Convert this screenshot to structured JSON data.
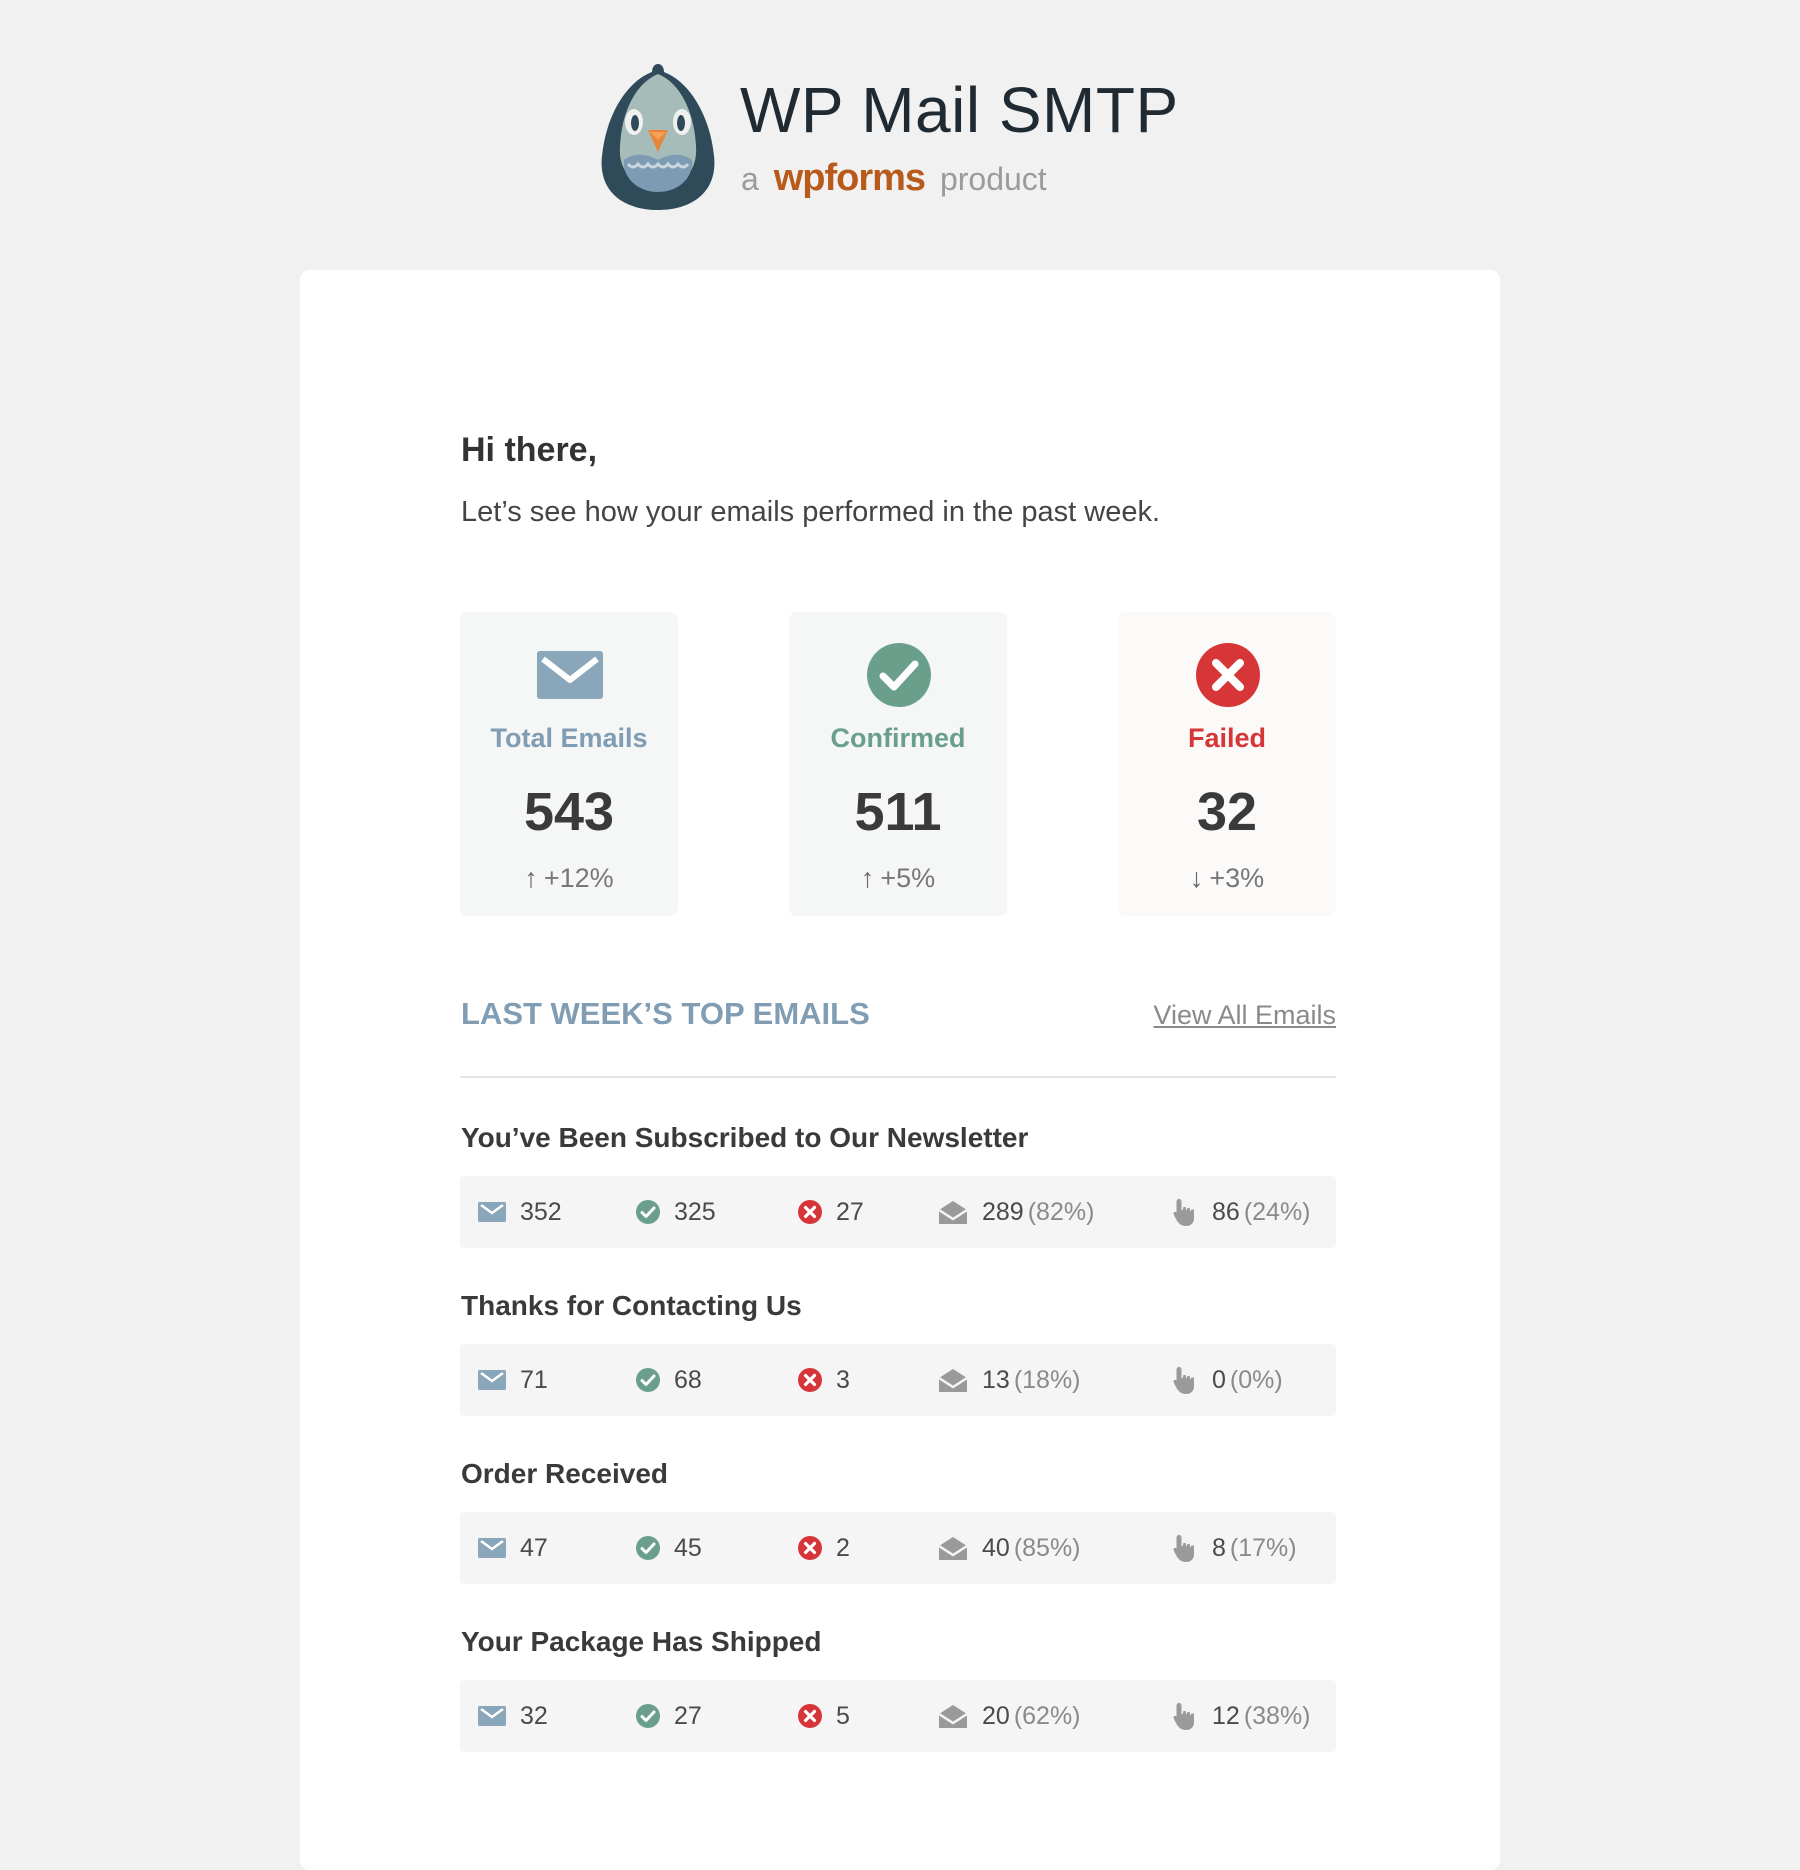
{
  "brand": {
    "title": "WP Mail SMTP",
    "sub_prefix": "a",
    "sub_brand": "wpforms",
    "sub_suffix": "product"
  },
  "greeting": "Hi there,",
  "intro": "Let’s see how your emails performed in the past week.",
  "stats": [
    {
      "label": "Total Emails",
      "value": "543",
      "arrow": "↑",
      "change": "+12%",
      "icon": "envelope-icon",
      "color": "#809db3"
    },
    {
      "label": "Confirmed",
      "value": "511",
      "arrow": "↑",
      "change": "+5%",
      "icon": "check-circle-icon",
      "color": "#6aa08b"
    },
    {
      "label": "Failed",
      "value": "32",
      "arrow": "↓",
      "change": "+3%",
      "icon": "x-circle-icon",
      "color": "#d63638"
    }
  ],
  "section": {
    "title": "LAST WEEK’S TOP EMAILS",
    "view_all": "View All Emails"
  },
  "emails": [
    {
      "title": "You’ve Been Subscribed to Our Newsletter",
      "total": "352",
      "confirmed": "325",
      "failed": "27",
      "opened": "289",
      "opened_pct": "(82%)",
      "clicked": "86",
      "clicked_pct": "(24%)"
    },
    {
      "title": "Thanks for Contacting Us",
      "total": "71",
      "confirmed": "68",
      "failed": "3",
      "opened": "13",
      "opened_pct": "(18%)",
      "clicked": "0",
      "clicked_pct": "(0%)"
    },
    {
      "title": "Order Received",
      "total": "47",
      "confirmed": "45",
      "failed": "2",
      "opened": "40",
      "opened_pct": "(85%)",
      "clicked": "8",
      "clicked_pct": "(17%)"
    },
    {
      "title": "Your Package Has Shipped",
      "total": "32",
      "confirmed": "27",
      "failed": "5",
      "opened": "20",
      "opened_pct": "(62%)",
      "clicked": "12",
      "clicked_pct": "(38%)"
    }
  ],
  "colors": {
    "page_bg": "#f1f1f1",
    "accent_blue": "#809db3",
    "success_green": "#6aa08b",
    "error_red": "#d63638",
    "wpforms_orange": "#b85a1b"
  }
}
